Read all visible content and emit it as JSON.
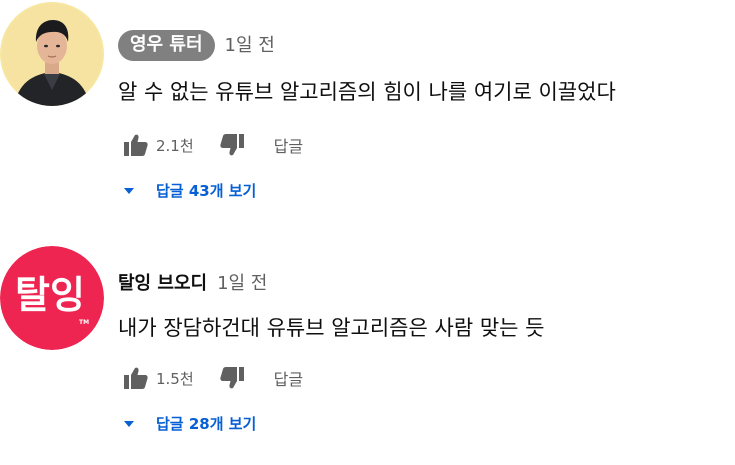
{
  "comments": [
    {
      "author": "영우 튜터",
      "time": "1일 전",
      "text": "알 수 없는 유튜브 알고리즘의 힘이 나를 여기로 이끌었다",
      "likes": "2.1천",
      "reply_label": "답글",
      "replies_label": "답글 43개 보기",
      "avatar_icon": "person-photo-avatar",
      "author_style": "highlighted-chip"
    },
    {
      "author": "탈잉 브오디",
      "time": "1일 전",
      "text": "내가 장담하건대 유튜브 알고리즘은 사람 맞는 듯",
      "likes": "1.5천",
      "reply_label": "답글",
      "replies_label": "답글 28개 보기",
      "avatar_icon": "brand-logo-avatar",
      "avatar_logo_text": "탈잉",
      "avatar_logo_mark": "TM",
      "author_style": "plain"
    }
  ],
  "colors": {
    "link_blue": "#065fd4",
    "secondary_text": "#606060",
    "chip_bg": "#808080",
    "avatar1_bg": "#f7e6a0",
    "avatar2_bg": "#ee2551"
  }
}
